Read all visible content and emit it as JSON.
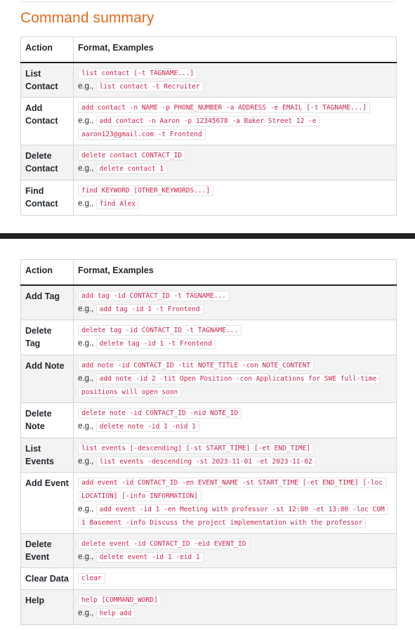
{
  "heading": "Command summary",
  "table1": {
    "headers": [
      "Action",
      "Format, Examples"
    ],
    "rows": [
      {
        "action": "List Contact",
        "format": "list contact [-t TAGNAME...]",
        "eg": "e.g.,",
        "example": "list contact -t Recruiter"
      },
      {
        "action": "Add Contact",
        "format": "add contact -n NAME -p PHONE_NUMBER -a ADDRESS -e EMAIL [-t TAGNAME...]",
        "eg": "e.g.,",
        "example": "add contact -n Aaron -p 12345678 -a Baker Street 12 -e aaron123@gmail.com -t Frontend"
      },
      {
        "action": "Delete Contact",
        "format": "delete contact CONTACT_ID",
        "eg": "e.g.,",
        "example": "delete contact 1"
      },
      {
        "action": "Find Contact",
        "format": "find KEYWORD [OTHER_KEYWORDS...]",
        "eg": "e.g.,",
        "example": "find Alex"
      }
    ]
  },
  "table2": {
    "headers": [
      "Action",
      "Format, Examples"
    ],
    "rows": [
      {
        "action": "Add Tag",
        "format": "add tag -id CONTACT_ID -t TAGNAME...",
        "eg": "e.g.,",
        "example": "add tag -id 1 -t Frontend"
      },
      {
        "action": "Delete Tag",
        "format": "delete tag -id CONTACT_ID -t TAGNAME...",
        "eg": "e.g.,",
        "example": "delete tag -id 1 -t Frontend"
      },
      {
        "action": "Add Note",
        "format": "add note -id CONTACT_ID -tit NOTE_TITLE -con NOTE_CONTENT",
        "eg": "e.g.,",
        "example": "add note -id 2 -tit Open Position -con Applications for SWE full-time positions will open soon"
      },
      {
        "action": "Delete Note",
        "format": "delete note -id CONTACT_ID -nid NOTE_ID",
        "eg": "e.g.,",
        "example": "delete note -id 1 -nid 1"
      },
      {
        "action": "List Events",
        "format": "list events [-descending] [-st START_TIME] [-et END_TIME]",
        "eg": "e.g.,",
        "example": "list events -descending -st 2023-11-01 -et 2023-11-02"
      },
      {
        "action": "Add Event",
        "format": "add event -id CONTACT_ID -en EVENT_NAME -st START_TIME [-et END_TIME] [-loc LOCATION] [-info INFORMATION]",
        "eg": "e.g.,",
        "example": "add event -id 1 -en Meeting with professor -st 12:00 -et 13:00 -loc COM 1 Basement -info Discuss the project implementation with the professor"
      },
      {
        "action": "Delete Event",
        "format": "delete event -id CONTACT_ID -eid EVENT_ID",
        "eg": "e.g.,",
        "example": "delete event -id 1 -eid 1"
      },
      {
        "action": "Clear Data",
        "format": "clear",
        "eg": "",
        "example": ""
      },
      {
        "action": "Help",
        "format": "help [COMMAND_WORD]",
        "eg": "e.g.,",
        "example": "help add"
      }
    ]
  }
}
